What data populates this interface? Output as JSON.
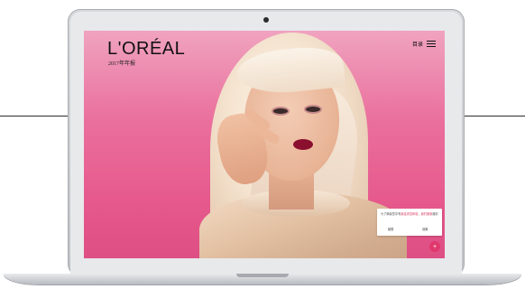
{
  "site": {
    "logo": "L'ORÉAL",
    "tagline": "2017年年报",
    "menu_label": "目录"
  },
  "cookie_notice": {
    "text_plain": "为了确保您享有",
    "text_highlight": "最佳浏览体验，我们使用",
    "text_tail": "缓存",
    "button_accept": "接受",
    "button_settings": "设置"
  },
  "icons": {
    "menu": "hamburger-icon",
    "fab": "plus-icon"
  },
  "colors": {
    "background_pink": "#e6598c",
    "accent": "#d6335e",
    "lips": "#8b0f2e"
  }
}
